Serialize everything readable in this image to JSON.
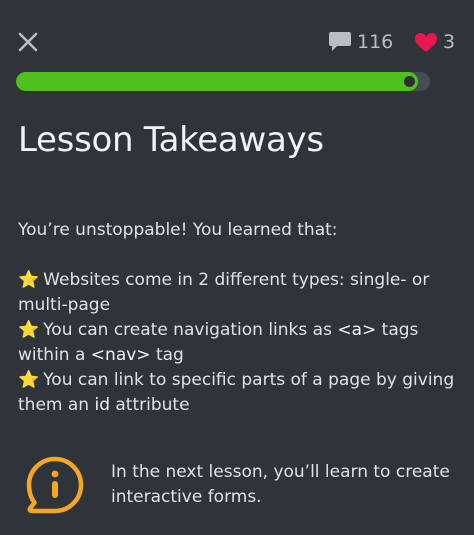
{
  "header": {
    "comments_count": "116",
    "hearts_count": "3"
  },
  "progress": {
    "value": 0.97
  },
  "lesson": {
    "title": "Lesson Takeaways",
    "intro": "You’re unstoppable! You learned that:",
    "takeaways": [
      {
        "star": "⭐",
        "text_a": "Websites come in 2 different types: single- or multi-page"
      },
      {
        "star": "⭐",
        "text_a": "You can create navigation links as ",
        "code_a": "<a>",
        "text_b": " tags within a ",
        "code_b": "<nav>",
        "text_c": " tag"
      },
      {
        "star": "⭐",
        "text_a": "You can link to specific parts of a page by giving them an ",
        "code_a": "id",
        "text_b": " attribute"
      }
    ]
  },
  "tip": {
    "text": "In the next lesson, you’ll learn to create interactive forms."
  },
  "colors": {
    "background": "#2f343b",
    "progress_fill": "#4fc11e",
    "heart": "#e8174f",
    "info_accent": "#f5a623"
  },
  "icons": {
    "close": "close-icon",
    "comments": "speech-bubble-icon",
    "hearts": "heart-icon",
    "tip": "info-bubble-icon"
  }
}
